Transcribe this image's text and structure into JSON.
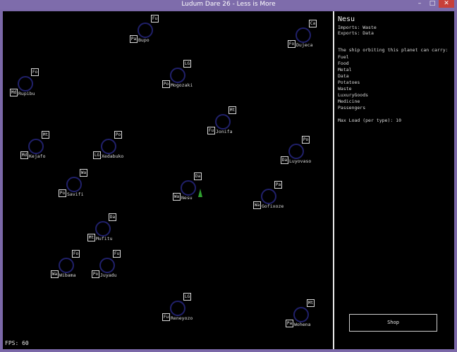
{
  "window": {
    "title": "Ludum Dare 26 - Less is More",
    "minimize": "–",
    "maximize": "□",
    "close": "✕"
  },
  "hud": {
    "fps": "FPS: 60"
  },
  "planets": [
    {
      "name": "Bupo",
      "badge_tr": "Fu",
      "badge_bl": "Pa"
    },
    {
      "name": "Dujeca",
      "badge_tr": "Ca",
      "badge_bl": "Fo"
    },
    {
      "name": "Rupibu",
      "badge_tr": "Fo",
      "badge_bl": "Md"
    },
    {
      "name": "Mogozaki",
      "badge_tr": "LG",
      "badge_bl": "Po"
    },
    {
      "name": "Jonifa",
      "badge_tr": "Mt",
      "badge_bl": "Fu"
    },
    {
      "name": "Kejafo",
      "badge_tr": "Mt",
      "badge_bl": "Md"
    },
    {
      "name": "Xedabuko",
      "badge_tr": "Po",
      "badge_bl": "LG"
    },
    {
      "name": "Luyovaso",
      "badge_tr": "Po",
      "badge_bl": "Da"
    },
    {
      "name": "Savifi",
      "badge_tr": "Wa",
      "badge_bl": "Po"
    },
    {
      "name": "Nesu",
      "badge_tr": "Da",
      "badge_bl": "Wa"
    },
    {
      "name": "Gofixoze",
      "badge_tr": "Pa",
      "badge_bl": "Wa"
    },
    {
      "name": "Mufitu",
      "badge_tr": "Da",
      "badge_bl": "Mt"
    },
    {
      "name": "Wibama",
      "badge_tr": "Fo",
      "badge_bl": "Wa"
    },
    {
      "name": "Juyadu",
      "badge_tr": "Fu",
      "badge_bl": "Po"
    },
    {
      "name": "Reneyozo",
      "badge_tr": "LG",
      "badge_bl": "Fu"
    },
    {
      "name": "Wohena",
      "badge_tr": "Mt",
      "badge_bl": "Pa"
    }
  ],
  "panel": {
    "planet_name": "Nesu",
    "imports": "Imports: Waste",
    "exports": "Exports: Data",
    "carry_heading": "The ship orbiting this planet can carry:",
    "cargo": [
      "Fuel",
      "Food",
      "Metal",
      "Data",
      "Potatoes",
      "Waste",
      "LuxuryGoods",
      "Medicine",
      "Passengers"
    ],
    "max_load": "Max Load (per type): 10",
    "shop_label": "Shop"
  }
}
